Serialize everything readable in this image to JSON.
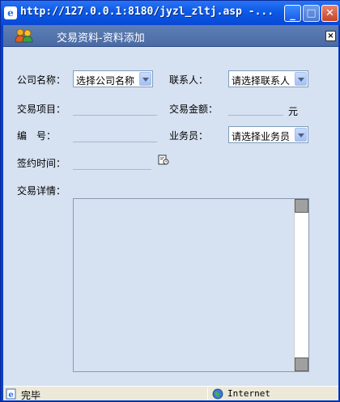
{
  "window": {
    "title": "http://127.0.0.1:8180/jyzl_zltj.asp -..."
  },
  "dialog": {
    "title": "交易资料-资料添加",
    "close_label": "×"
  },
  "form": {
    "company_label": "公司名称：",
    "company_select": "选择公司名称",
    "contact_label": "联系人：",
    "contact_select": "请选择联系人",
    "item_label": "交易项目：",
    "amount_label": "交易金额：",
    "amount_unit": "元",
    "code_label": "编　号：",
    "salesman_label": "业务员：",
    "salesman_select": "请选择业务员",
    "sign_time_label": "签约时间：",
    "detail_label": "交易详情："
  },
  "statusbar": {
    "status": "完毕",
    "zone": "Internet"
  },
  "colors": {
    "titlebar": "#0c5ae6",
    "dialog_header": "#4a6aa4",
    "form_bg": "#d6e1f1"
  }
}
